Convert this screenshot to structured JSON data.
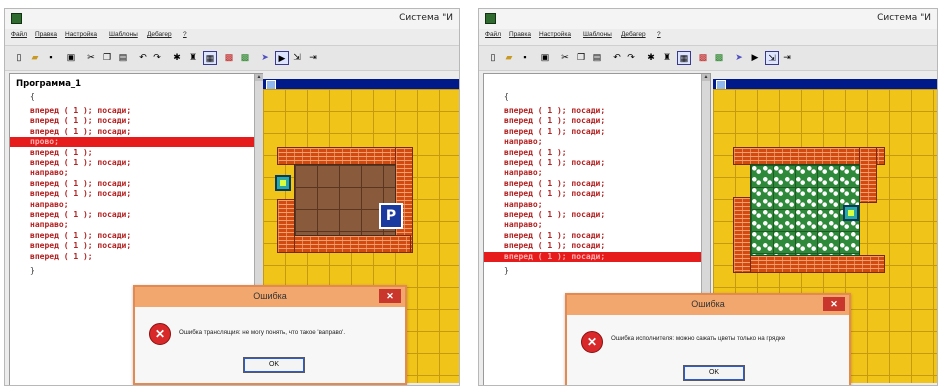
{
  "menu": [
    "Файл",
    "Правка",
    "Настройка",
    "Шаблоны",
    "Дебагер",
    "?"
  ],
  "left": {
    "title": "Система \"И",
    "program_title": "Программа_1",
    "code": [
      {
        "text": "{",
        "kind": "brace"
      },
      {
        "text": "вперед ( 1 ); посади;",
        "kind": "code"
      },
      {
        "text": "вперед ( 1 ); посади;",
        "kind": "code"
      },
      {
        "text": "вперед ( 1 ); посади;",
        "kind": "code"
      },
      {
        "text": "прово;",
        "kind": "error"
      },
      {
        "text": "вперед ( 1 );",
        "kind": "code"
      },
      {
        "text": "вперед ( 1 ); посади;",
        "kind": "code"
      },
      {
        "text": "направо;",
        "kind": "code"
      },
      {
        "text": "вперед ( 1 ); посади;",
        "kind": "code"
      },
      {
        "text": "вперед ( 1 ); посади;",
        "kind": "code"
      },
      {
        "text": "направо;",
        "kind": "code"
      },
      {
        "text": "вперед ( 1 ); посади;",
        "kind": "code"
      },
      {
        "text": "направо;",
        "kind": "code"
      },
      {
        "text": "вперед ( 1 ); посади;",
        "kind": "code"
      },
      {
        "text": "вперед ( 1 ); посади;",
        "kind": "code"
      },
      {
        "text": "вперед ( 1 );",
        "kind": "code"
      },
      {
        "text": "}",
        "kind": "brace"
      }
    ],
    "dialog": {
      "title": "Ошибка",
      "message": "Ошибка транслящия: не могу понять, что такое 'ваправо'.",
      "ok": "OK"
    }
  },
  "right": {
    "title": "Система \"И",
    "program_title": "",
    "code": [
      {
        "text": "{",
        "kind": "brace"
      },
      {
        "text": "вперед ( 1 ); посади;",
        "kind": "code"
      },
      {
        "text": "вперед ( 1 ); посади;",
        "kind": "code"
      },
      {
        "text": "вперед ( 1 ); посади;",
        "kind": "code"
      },
      {
        "text": "направо;",
        "kind": "code"
      },
      {
        "text": "вперед ( 1 );",
        "kind": "code"
      },
      {
        "text": "вперед ( 1 ); посади;",
        "kind": "code"
      },
      {
        "text": "направо;",
        "kind": "code"
      },
      {
        "text": "вперед ( 1 ); посади;",
        "kind": "code"
      },
      {
        "text": "вперед ( 1 ); посади;",
        "kind": "code"
      },
      {
        "text": "направо;",
        "kind": "code"
      },
      {
        "text": "вперед ( 1 ); посади;",
        "kind": "code"
      },
      {
        "text": "направо;",
        "kind": "code"
      },
      {
        "text": "вперед ( 1 ); посади;",
        "kind": "code"
      },
      {
        "text": "вперед ( 1 ); посади;",
        "kind": "code"
      },
      {
        "text": "вперед ( 1 ); посади;",
        "kind": "error"
      },
      {
        "text": "}",
        "kind": "brace"
      }
    ],
    "dialog": {
      "title": "Ошибка",
      "message": "Ошибка исполнителя: можно сажать цветы только на грядке",
      "ok": "OK"
    }
  },
  "field": {
    "left_sign": "P",
    "right_sign": ""
  },
  "colors": {
    "error_line": "#e61c1c",
    "code_text": "#b32020",
    "field_bg": "#f0c419",
    "brick": "#d24a10",
    "dialog_title": "#f2a76f"
  }
}
